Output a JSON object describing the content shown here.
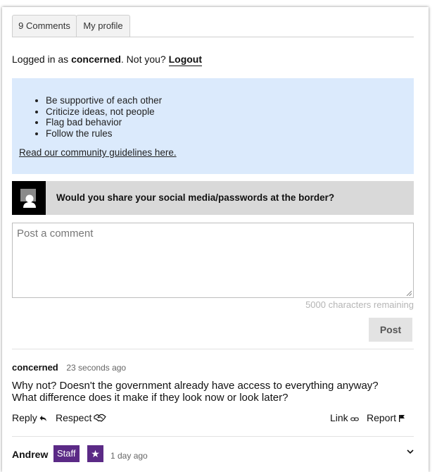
{
  "tabs": [
    {
      "label": "9 Comments"
    },
    {
      "label": "My profile"
    }
  ],
  "session": {
    "prefix": "Logged in as ",
    "username": "concerned",
    "middle": ". Not you? ",
    "logout_label": "Logout"
  },
  "guidelines": {
    "items": [
      "Be supportive of each other",
      "Criticize ideas, not people",
      "Flag bad behavior",
      "Follow the rules"
    ],
    "link_text": "Read our community guidelines here."
  },
  "question": {
    "text": "Would you share your social media/passwords at the border?"
  },
  "composer": {
    "placeholder": "Post a comment",
    "chars_remaining": "5000 characters remaining",
    "post_label": "Post"
  },
  "comments": [
    {
      "author": "concerned",
      "time": "23 seconds ago",
      "line1": "Why not? Doesn't the government already have access to everything anyway?",
      "line2": "What difference does it make if they look now or look later?",
      "actions": {
        "reply": "Reply",
        "respect": "Respect",
        "link": "Link",
        "report": "Report"
      }
    },
    {
      "author": "Andrew",
      "badge": "Staff",
      "badge_star": "★",
      "time": "1 day ago"
    }
  ],
  "colors": {
    "guidelines_bg": "#dbeafc",
    "question_bg": "#d9d9d9",
    "staff_badge": "#5b2a86",
    "post_button_bg": "#e3e3e3"
  },
  "icons": [
    "person-placeholder-icon",
    "reply-arrow-icon",
    "handshake-icon",
    "link-chain-icon",
    "flag-icon",
    "chevron-down-icon",
    "resize-grip-icon"
  ]
}
